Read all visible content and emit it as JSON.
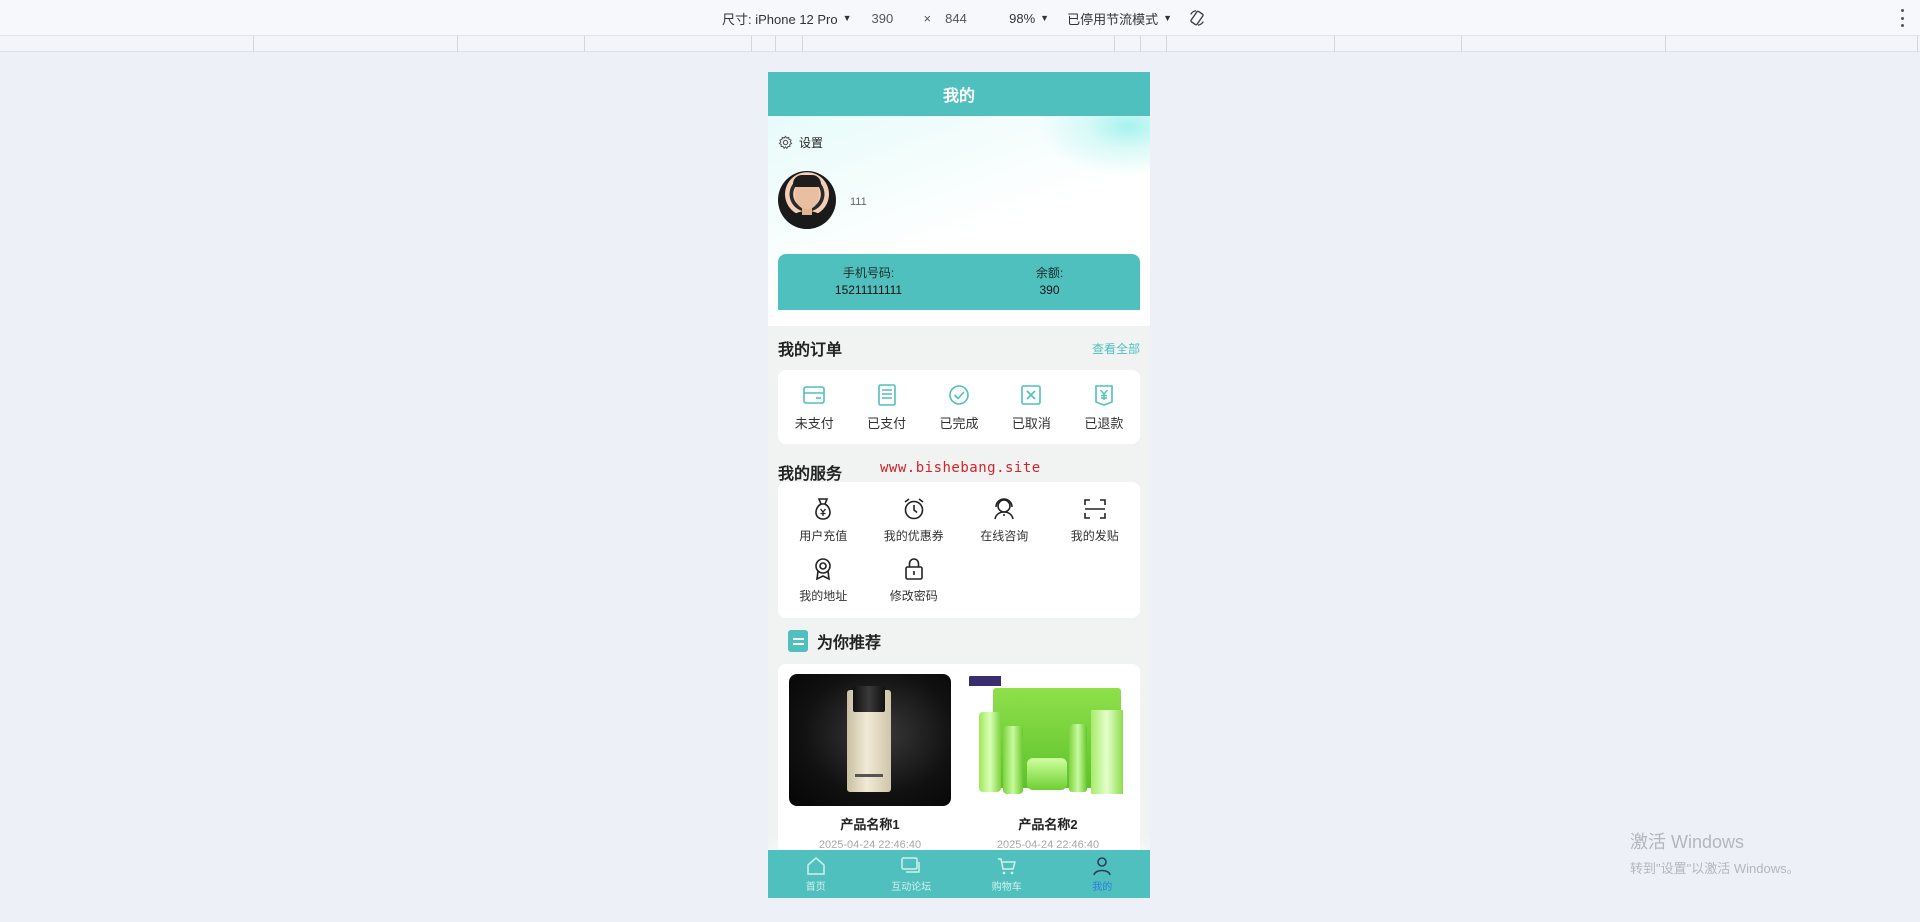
{
  "devtools": {
    "device_label": "尺寸: iPhone 12 Pro",
    "width": "390",
    "times": "×",
    "height": "844",
    "zoom": "98%",
    "throttle": "已停用节流模式"
  },
  "page": {
    "title": "我的"
  },
  "profile": {
    "settings_label": "设置",
    "username": "111",
    "phone_label": "手机号码:",
    "phone_value": "15211111111",
    "balance_label": "余额:",
    "balance_value": "390"
  },
  "orders": {
    "title": "我的订单",
    "view_all": "查看全部",
    "items": [
      {
        "label": "未支付",
        "icon": "wallet-icon"
      },
      {
        "label": "已支付",
        "icon": "receipt-icon"
      },
      {
        "label": "已完成",
        "icon": "check-circle-icon"
      },
      {
        "label": "已取消",
        "icon": "cancel-box-icon"
      },
      {
        "label": "已退款",
        "icon": "yen-refund-icon"
      }
    ]
  },
  "services": {
    "title": "我的服务",
    "items": [
      {
        "label": "用户充值",
        "icon": "money-bag-icon"
      },
      {
        "label": "我的优惠券",
        "icon": "alarm-clock-icon"
      },
      {
        "label": "在线咨询",
        "icon": "headset-icon"
      },
      {
        "label": "我的发贴",
        "icon": "scan-icon"
      },
      {
        "label": "我的地址",
        "icon": "location-badge-icon"
      },
      {
        "label": "修改密码",
        "icon": "lock-icon"
      }
    ]
  },
  "watermark": "www.bishebang.site",
  "recommend": {
    "title": "为你推荐",
    "products": [
      {
        "name": "产品名称1",
        "date": "2025-04-24 22:46:40"
      },
      {
        "name": "产品名称2",
        "date": "2025-04-24 22:46:40"
      }
    ]
  },
  "tabbar": {
    "tabs": [
      {
        "label": "首页",
        "icon": "home-icon"
      },
      {
        "label": "互动论坛",
        "icon": "forum-icon"
      },
      {
        "label": "购物车",
        "icon": "cart-icon"
      },
      {
        "label": "我的",
        "icon": "user-icon"
      }
    ]
  },
  "windows_activation": {
    "line1": "激活 Windows",
    "line2": "转到\"设置\"以激活 Windows。"
  },
  "colors": {
    "accent": "#4fc0bd",
    "active_tab": "#2f7de0",
    "watermark": "#d6202a"
  }
}
